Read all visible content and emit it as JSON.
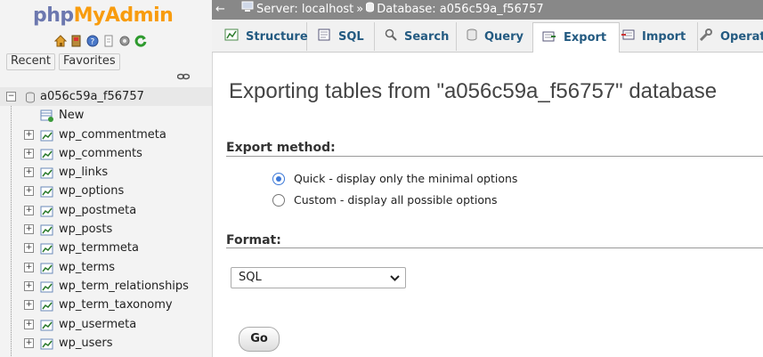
{
  "app": {
    "logo_part1": "php",
    "logo_part2": "MyAdmin"
  },
  "nav": {
    "icons": [
      "home-icon",
      "logout-icon",
      "help-icon",
      "docs-icon",
      "settings-icon",
      "reload-icon"
    ],
    "recent_label": "Recent",
    "favorites_label": "Favorites",
    "database": "a056c59a_f56757",
    "new_label": "New",
    "tables": [
      "wp_commentmeta",
      "wp_comments",
      "wp_links",
      "wp_options",
      "wp_postmeta",
      "wp_posts",
      "wp_termmeta",
      "wp_terms",
      "wp_term_relationships",
      "wp_term_taxonomy",
      "wp_usermeta",
      "wp_users"
    ]
  },
  "breadcrumb": {
    "server": "Server: localhost",
    "separator": "»",
    "database": "Database: a056c59a_f56757"
  },
  "tabs": [
    {
      "label": "Structure",
      "icon": "structure-icon"
    },
    {
      "label": "SQL",
      "icon": "sql-icon"
    },
    {
      "label": "Search",
      "icon": "search-icon"
    },
    {
      "label": "Query",
      "icon": "query-icon"
    },
    {
      "label": "Export",
      "icon": "export-icon",
      "active": true
    },
    {
      "label": "Import",
      "icon": "import-icon"
    },
    {
      "label": "Operati",
      "icon": "operations-icon"
    }
  ],
  "main": {
    "title": "Exporting tables from \"a056c59a_f56757\" database",
    "export_method_heading": "Export method:",
    "quick_option": "Quick - display only the minimal options",
    "custom_option": "Custom - display all possible options",
    "format_heading": "Format:",
    "format_selected": "SQL",
    "go_label": "Go"
  },
  "colors": {
    "logo_php": "#6c78af",
    "logo_myadmin": "#f89c0e",
    "tab_text": "#235a81",
    "topbar_bg": "#888888"
  }
}
